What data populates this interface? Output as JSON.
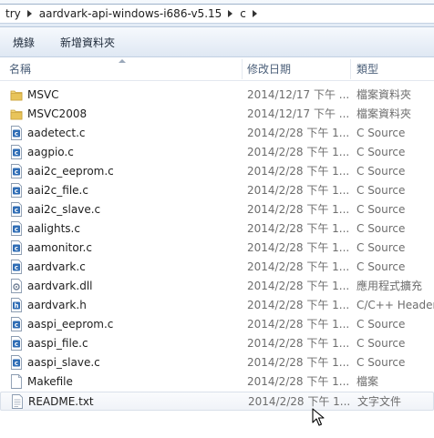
{
  "breadcrumb": [
    "try",
    "aardvark-api-windows-i686-v5.15",
    "c"
  ],
  "toolbar": {
    "burn_label": "燒錄",
    "new_folder_label": "新增資料夾"
  },
  "columns": {
    "name": "名稱",
    "date": "修改日期",
    "type": "類型"
  },
  "files": [
    {
      "name": "MSVC",
      "date": "2014/12/17 下午 ...",
      "type": "檔案資料夾",
      "icon": "folder-icon"
    },
    {
      "name": "MSVC2008",
      "date": "2014/12/17 下午 ...",
      "type": "檔案資料夾",
      "icon": "folder-icon"
    },
    {
      "name": "aadetect.c",
      "date": "2014/2/28 下午 1...",
      "type": "C Source",
      "icon": "c-source-file-icon"
    },
    {
      "name": "aagpio.c",
      "date": "2014/2/28 下午 1...",
      "type": "C Source",
      "icon": "c-source-file-icon"
    },
    {
      "name": "aai2c_eeprom.c",
      "date": "2014/2/28 下午 1...",
      "type": "C Source",
      "icon": "c-source-file-icon"
    },
    {
      "name": "aai2c_file.c",
      "date": "2014/2/28 下午 1...",
      "type": "C Source",
      "icon": "c-source-file-icon"
    },
    {
      "name": "aai2c_slave.c",
      "date": "2014/2/28 下午 1...",
      "type": "C Source",
      "icon": "c-source-file-icon"
    },
    {
      "name": "aalights.c",
      "date": "2014/2/28 下午 1...",
      "type": "C Source",
      "icon": "c-source-file-icon"
    },
    {
      "name": "aamonitor.c",
      "date": "2014/2/28 下午 1...",
      "type": "C Source",
      "icon": "c-source-file-icon"
    },
    {
      "name": "aardvark.c",
      "date": "2014/2/28 下午 1...",
      "type": "C Source",
      "icon": "c-source-file-icon"
    },
    {
      "name": "aardvark.dll",
      "date": "2014/2/28 下午 1...",
      "type": "應用程式擴充",
      "icon": "dll-file-icon"
    },
    {
      "name": "aardvark.h",
      "date": "2014/2/28 下午 1...",
      "type": "C/C++ Header",
      "icon": "h-header-file-icon"
    },
    {
      "name": "aaspi_eeprom.c",
      "date": "2014/2/28 下午 1...",
      "type": "C Source",
      "icon": "c-source-file-icon"
    },
    {
      "name": "aaspi_file.c",
      "date": "2014/2/28 下午 1...",
      "type": "C Source",
      "icon": "c-source-file-icon"
    },
    {
      "name": "aaspi_slave.c",
      "date": "2014/2/28 下午 1...",
      "type": "C Source",
      "icon": "c-source-file-icon"
    },
    {
      "name": "Makefile",
      "date": "2014/2/28 下午 1...",
      "type": "檔案",
      "icon": "blank-file-icon"
    },
    {
      "name": "README.txt",
      "date": "2014/2/28 下午 1...",
      "type": "文字文件",
      "icon": "text-file-icon"
    }
  ],
  "hovered_row": 16,
  "colors": {
    "folder": "#e8c45a",
    "c_badge": "#2f6db5",
    "header_text": "#4c607a"
  }
}
